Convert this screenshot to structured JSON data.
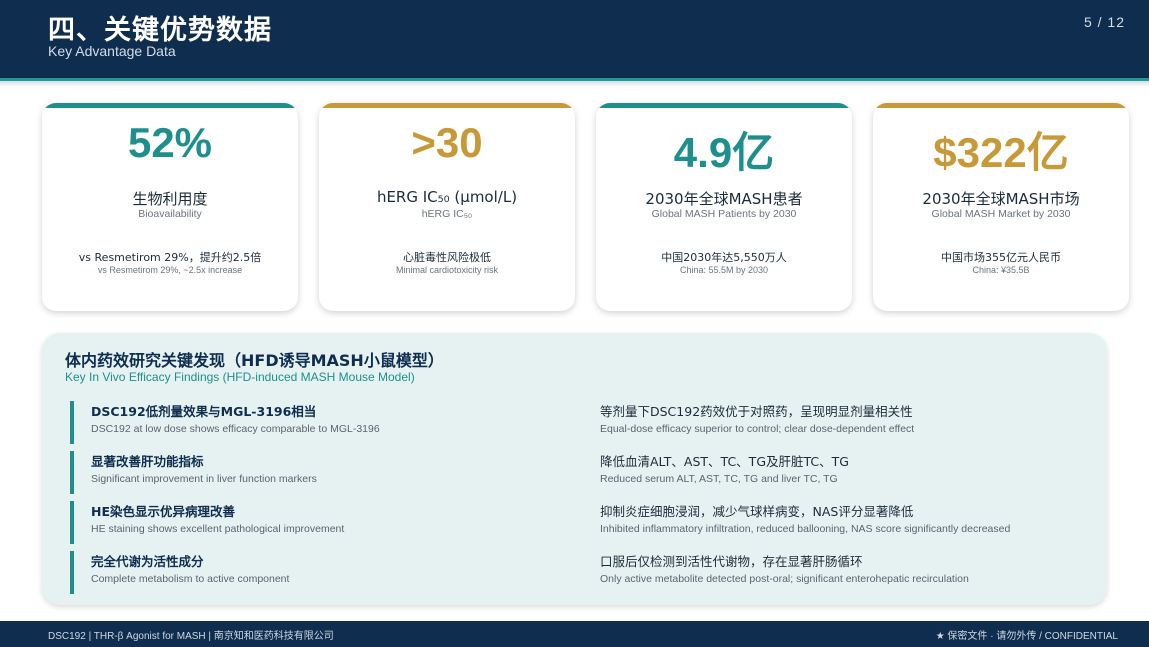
{
  "header": {
    "title": "四、关键优势数据",
    "subtitle": "Key Advantage Data",
    "page": "5 / 12"
  },
  "cards": [
    {
      "value": "52%",
      "accent": "teal",
      "label": "生物利用度",
      "label_en": "Bioavailability",
      "note": "vs Resmetirom 29%，提升约2.5倍",
      "note_en": "vs Resmetirom 29%, ~2.5x increase"
    },
    {
      "value": ">30",
      "accent": "gold",
      "label": "hERG IC₅₀ (μmol/L)",
      "label_en": "hERG IC₅₀",
      "note": "心脏毒性风险极低",
      "note_en": "Minimal cardiotoxicity risk"
    },
    {
      "value": "4.9亿",
      "accent": "teal",
      "label": "2030年全球MASH患者",
      "label_en": "Global MASH Patients by 2030",
      "note": "中国2030年达5,550万人",
      "note_en": "China: 55.5M by 2030"
    },
    {
      "value": "$322亿",
      "accent": "gold",
      "label": "2030年全球MASH市场",
      "label_en": "Global MASH Market by 2030",
      "note": "中国市场355亿元人民币",
      "note_en": "China: ¥35.5B"
    }
  ],
  "colors": {
    "navy": "#0f2d4e",
    "teal": "#1e8f8c",
    "gold": "#c79a37",
    "panel_bg": "#e6f2f2"
  },
  "panel": {
    "title": "体内药效研究关键发现（HFD诱导MASH小鼠模型）",
    "subtitle": "Key In Vivo Efficacy Findings (HFD-induced MASH Mouse Model)",
    "left": [
      {
        "title": "DSC192低剂量效果与MGL-3196相当",
        "desc": "DSC192 at low dose shows efficacy comparable to MGL-3196"
      },
      {
        "title": "显著改善肝功能指标",
        "desc": "Significant improvement in liver function markers"
      },
      {
        "title": "HE染色显示优异病理改善",
        "desc": "HE staining shows excellent pathological improvement"
      },
      {
        "title": "完全代谢为活性成分",
        "desc": "Complete metabolism to active component"
      }
    ],
    "right": [
      {
        "title": "等剂量下DSC192药效优于对照药，呈现明显剂量相关性",
        "desc": "Equal-dose efficacy superior to control; clear dose-dependent effect"
      },
      {
        "title": "降低血清ALT、AST、TC、TG及肝脏TC、TG",
        "desc": "Reduced serum ALT, AST, TC, TG and liver TC, TG"
      },
      {
        "title": "抑制炎症细胞浸润，减少气球样病变，NAS评分显著降低",
        "desc": "Inhibited inflammatory infiltration, reduced ballooning, NAS score significantly decreased"
      },
      {
        "title": "口服后仅检测到活性代谢物，存在显著肝肠循环",
        "desc": "Only active metabolite detected post-oral; significant enterohepatic recirculation"
      }
    ]
  },
  "footer": {
    "left": "DSC192 | THR-β Agonist for MASH | 南京知和医药科技有限公司",
    "right": "★ 保密文件 · 请勿外传 / CONFIDENTIAL"
  }
}
